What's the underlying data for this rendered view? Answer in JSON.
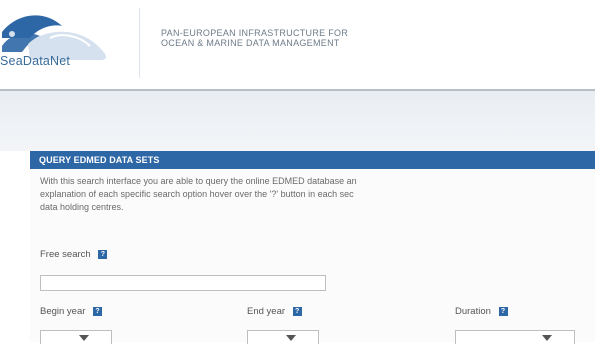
{
  "header": {
    "logo_text": "SeaDataNet",
    "tagline_line1": "PAN-EUROPEAN INFRASTRUCTURE FOR",
    "tagline_line2": "OCEAN & MARINE DATA MANAGEMENT"
  },
  "panel": {
    "title": "QUERY EDMED DATA SETS",
    "intro_line1": "With this search interface you are able to query the online EDMED database an",
    "intro_line2": "explanation of each specific search option hover over the '?' button in each sec",
    "intro_line3": "data holding centres.",
    "help_glyph": "?"
  },
  "form": {
    "free_search_label": "Free search",
    "free_search_value": "",
    "begin_year_label": "Begin year",
    "begin_year_value": "",
    "end_year_label": "End year",
    "end_year_value": "",
    "duration_label": "Duration",
    "duration_value": ""
  },
  "colors": {
    "accent": "#2e67a6",
    "logo_blue": "#3a6c9a"
  }
}
